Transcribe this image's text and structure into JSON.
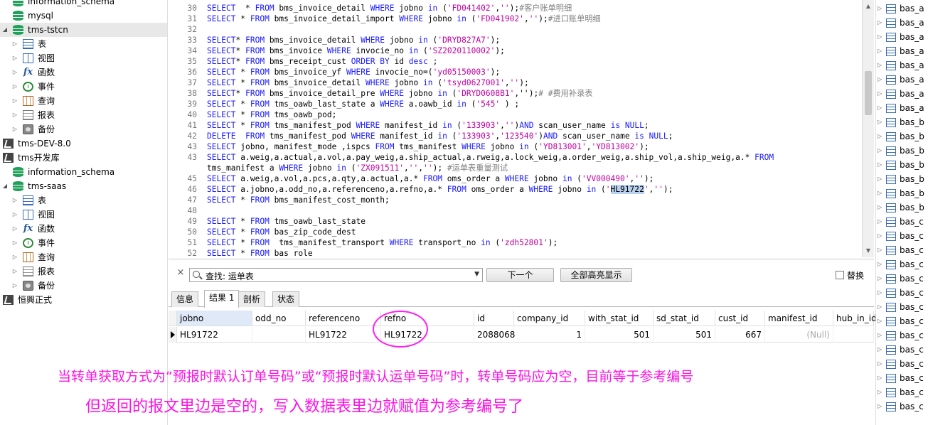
{
  "tree": [
    {
      "label": "information_schema",
      "icon": "database-icon",
      "indent": 1,
      "arrow": ""
    },
    {
      "label": "mysql",
      "icon": "database-icon",
      "indent": 1,
      "arrow": ""
    },
    {
      "label": "tms-tstcn",
      "icon": "database-icon",
      "indent": 1,
      "arrow": "open",
      "selected": true
    },
    {
      "label": "表",
      "icon": "table-icon",
      "indent": 2,
      "arrow": "closed"
    },
    {
      "label": "视图",
      "icon": "view-icon",
      "indent": 2,
      "arrow": "closed"
    },
    {
      "label": "函数",
      "icon": "function-icon",
      "indent": 2,
      "arrow": "closed"
    },
    {
      "label": "事件",
      "icon": "event-icon",
      "indent": 2,
      "arrow": "closed"
    },
    {
      "label": "查询",
      "icon": "query-icon",
      "indent": 2,
      "arrow": "closed"
    },
    {
      "label": "报表",
      "icon": "report-icon",
      "indent": 2,
      "arrow": "closed"
    },
    {
      "label": "备份",
      "icon": "backup-icon",
      "indent": 2,
      "arrow": "closed"
    },
    {
      "label": "tms-DEV-8.0",
      "icon": "connection-icon",
      "indent": 0,
      "arrow": ""
    },
    {
      "label": "tms开发库",
      "icon": "connection-icon",
      "indent": 0,
      "arrow": ""
    },
    {
      "label": "information_schema",
      "icon": "database-icon",
      "indent": 1,
      "arrow": ""
    },
    {
      "label": "tms-saas",
      "icon": "database-icon",
      "indent": 1,
      "arrow": "open"
    },
    {
      "label": "表",
      "icon": "table-icon",
      "indent": 2,
      "arrow": "closed"
    },
    {
      "label": "视图",
      "icon": "view-icon",
      "indent": 2,
      "arrow": "closed"
    },
    {
      "label": "函数",
      "icon": "function-icon",
      "indent": 2,
      "arrow": "closed"
    },
    {
      "label": "事件",
      "icon": "event-icon",
      "indent": 2,
      "arrow": "closed"
    },
    {
      "label": "查询",
      "icon": "query-icon",
      "indent": 2,
      "arrow": "closed"
    },
    {
      "label": "报表",
      "icon": "report-icon",
      "indent": 2,
      "arrow": "closed"
    },
    {
      "label": "备份",
      "icon": "backup-icon",
      "indent": 2,
      "arrow": "closed"
    },
    {
      "label": "恒興正式",
      "icon": "connection-icon",
      "indent": 0,
      "arrow": ""
    }
  ],
  "fx_glyph": "fx",
  "editor": {
    "lines": [
      {
        "n": "30",
        "tokens": [
          [
            "kw",
            "SELECT"
          ],
          [
            "",
            "  * "
          ],
          [
            "kw",
            "FROM"
          ],
          [
            "",
            " bms_invoice_detail "
          ],
          [
            "kw",
            "WHERE"
          ],
          [
            "",
            " jobno "
          ],
          [
            "kw",
            "in"
          ],
          [
            "",
            " ("
          ],
          [
            "str",
            "'FD041402'"
          ],
          [
            "",
            ","
          ],
          [
            "str",
            "''"
          ],
          [
            "",
            ");"
          ],
          [
            "cmt",
            "#客户账单明细"
          ]
        ]
      },
      {
        "n": "31",
        "tokens": [
          [
            "kw",
            "SELECT"
          ],
          [
            "",
            " * "
          ],
          [
            "kw",
            "FROM"
          ],
          [
            "",
            " bms_invoice_detail_import "
          ],
          [
            "kw",
            "WHERE"
          ],
          [
            "",
            " jobno "
          ],
          [
            "kw",
            "in"
          ],
          [
            "",
            " ("
          ],
          [
            "str",
            "'FD041902'"
          ],
          [
            "",
            ","
          ],
          [
            "str",
            "''"
          ],
          [
            "",
            ");"
          ],
          [
            "cmt",
            "#进口账单明细"
          ]
        ]
      },
      {
        "n": "32",
        "tokens": []
      },
      {
        "n": "33",
        "tokens": [
          [
            "kw",
            "SELECT"
          ],
          [
            "",
            "* "
          ],
          [
            "kw",
            "FROM"
          ],
          [
            "",
            " bms_invoice_detail "
          ],
          [
            "kw",
            "WHERE"
          ],
          [
            "",
            " jobno "
          ],
          [
            "kw",
            "in"
          ],
          [
            "",
            " ("
          ],
          [
            "str",
            "'DRYD827A7'"
          ],
          [
            "",
            ");"
          ]
        ]
      },
      {
        "n": "34",
        "tokens": [
          [
            "kw",
            "SELECT"
          ],
          [
            "",
            "* "
          ],
          [
            "kw",
            "FROM"
          ],
          [
            "",
            " bms_invoice "
          ],
          [
            "kw",
            "WHERE"
          ],
          [
            "",
            " invocie_no "
          ],
          [
            "kw",
            "in"
          ],
          [
            "",
            " ("
          ],
          [
            "str",
            "'SZ2020110002'"
          ],
          [
            "",
            ");"
          ]
        ]
      },
      {
        "n": "35",
        "tokens": [
          [
            "kw",
            "SELECT"
          ],
          [
            "",
            "* "
          ],
          [
            "kw",
            "FROM"
          ],
          [
            "",
            " bms_receipt_cust "
          ],
          [
            "kw",
            "ORDER BY"
          ],
          [
            "",
            " id "
          ],
          [
            "kw",
            "desc"
          ],
          [
            "",
            " ;"
          ]
        ]
      },
      {
        "n": "36",
        "tokens": [
          [
            "kw",
            "SELECT"
          ],
          [
            "",
            " * "
          ],
          [
            "kw",
            "FROM"
          ],
          [
            "",
            " bms_invoice_yf "
          ],
          [
            "kw",
            "WHERE"
          ],
          [
            "",
            " invocie_no=("
          ],
          [
            "str",
            "'yd05150003'"
          ],
          [
            "",
            ");"
          ]
        ]
      },
      {
        "n": "37",
        "tokens": [
          [
            "kw",
            "SELECT"
          ],
          [
            "",
            " * "
          ],
          [
            "kw",
            "FROM"
          ],
          [
            "",
            " bms_invoice_detail "
          ],
          [
            "kw",
            "WHERE"
          ],
          [
            "",
            " jobno "
          ],
          [
            "kw",
            "in"
          ],
          [
            "",
            " ("
          ],
          [
            "str",
            "'tsyd0627001'"
          ],
          [
            "",
            ","
          ],
          [
            "str",
            "''"
          ],
          [
            "",
            ");"
          ]
        ]
      },
      {
        "n": "38",
        "tokens": [
          [
            "kw",
            "SELECT"
          ],
          [
            "",
            "* "
          ],
          [
            "kw",
            "FROM"
          ],
          [
            "",
            " bms_invoice_detail_pre "
          ],
          [
            "kw",
            "WHERE"
          ],
          [
            "",
            " jobno "
          ],
          [
            "kw",
            "in"
          ],
          [
            "",
            " ("
          ],
          [
            "str",
            "'DRYD0608B1'"
          ],
          [
            "",
            ",'');"
          ],
          [
            "cmt",
            "# #费用补录表"
          ]
        ]
      },
      {
        "n": "39",
        "tokens": [
          [
            "kw",
            "SELECT"
          ],
          [
            "",
            " * "
          ],
          [
            "kw",
            "FROM"
          ],
          [
            "",
            " tms_oawb_last_state a "
          ],
          [
            "kw",
            "WHERE"
          ],
          [
            "",
            " a.oawb_id "
          ],
          [
            "kw",
            "in"
          ],
          [
            "",
            " ("
          ],
          [
            "str",
            "'545'"
          ],
          [
            "",
            " ) ;"
          ]
        ]
      },
      {
        "n": "40",
        "tokens": [
          [
            "kw",
            "SELECT"
          ],
          [
            "",
            " * "
          ],
          [
            "kw",
            "FROM"
          ],
          [
            "",
            " tms_oawb_pod;"
          ]
        ]
      },
      {
        "n": "41",
        "tokens": [
          [
            "kw",
            "SELECT"
          ],
          [
            "",
            " * "
          ],
          [
            "kw",
            "FROM"
          ],
          [
            "",
            " tms_manifest_pod "
          ],
          [
            "kw",
            "WHERE"
          ],
          [
            "",
            " manifest_id "
          ],
          [
            "kw",
            "in"
          ],
          [
            "",
            " ("
          ],
          [
            "str",
            "'133903'"
          ],
          [
            "",
            ","
          ],
          [
            "str",
            "''"
          ],
          [
            "",
            ")"
          ],
          [
            "kw",
            "AND"
          ],
          [
            "",
            " scan_user_name "
          ],
          [
            "kw",
            "is NULL"
          ],
          [
            "",
            ";"
          ]
        ]
      },
      {
        "n": "42",
        "tokens": [
          [
            "kw",
            "DELETE"
          ],
          [
            "",
            "  "
          ],
          [
            "kw",
            "FROM"
          ],
          [
            "",
            " tms_manifest_pod "
          ],
          [
            "kw",
            "WHERE"
          ],
          [
            "",
            " manifest_id "
          ],
          [
            "kw",
            "in"
          ],
          [
            "",
            " ("
          ],
          [
            "str",
            "'133903'"
          ],
          [
            "",
            ","
          ],
          [
            "str",
            "'123540'"
          ],
          [
            "",
            ")"
          ],
          [
            "kw",
            "AND"
          ],
          [
            "",
            " scan_user_name "
          ],
          [
            "kw",
            "is NULL"
          ],
          [
            "",
            ";"
          ]
        ]
      },
      {
        "n": "43",
        "tokens": [
          [
            "kw",
            "SELECT"
          ],
          [
            "",
            " jobno, manifest_mode ,ispcs "
          ],
          [
            "kw",
            "FROM"
          ],
          [
            "",
            " tms_manifest "
          ],
          [
            "kw",
            "WHERE"
          ],
          [
            "",
            " jobno "
          ],
          [
            "kw",
            "in"
          ],
          [
            "",
            " ("
          ],
          [
            "str",
            "'YD813001'"
          ],
          [
            "",
            ","
          ],
          [
            "str",
            "'YD813002'"
          ],
          [
            "",
            ");"
          ]
        ]
      },
      {
        "n": "43",
        "tokens": [
          [
            "kw",
            "SELECT"
          ],
          [
            "",
            " a.weig,a.actual,a.vol,a.pay_weig,a.ship_actual,a.rweig,a.lock_weig,a.order_weig,a.ship_vol,a.ship_weig,a.* "
          ],
          [
            "kw",
            "FROM"
          ]
        ]
      },
      {
        "n": "",
        "tokens": [
          [
            "",
            "tms_manifest a "
          ],
          [
            "kw",
            "WHERE"
          ],
          [
            "",
            " jobno "
          ],
          [
            "kw",
            "in"
          ],
          [
            "",
            " ("
          ],
          [
            "str",
            "'ZX091511'"
          ],
          [
            "",
            ","
          ],
          [
            "str",
            "''"
          ],
          [
            "",
            ","
          ],
          [
            "str",
            "''"
          ],
          [
            "",
            "); "
          ],
          [
            "cmt",
            "#运单表重量测试"
          ]
        ]
      },
      {
        "n": "45",
        "tokens": [
          [
            "kw",
            "SELECT"
          ],
          [
            "",
            " a.weig,a.vol,a.pcs,a.qty,a.actual,a.* "
          ],
          [
            "kw",
            "FROM"
          ],
          [
            "",
            " oms_order a "
          ],
          [
            "kw",
            "WHERE"
          ],
          [
            "",
            " jobno "
          ],
          [
            "kw",
            "in"
          ],
          [
            "",
            " ("
          ],
          [
            "str",
            "'VV000490'"
          ],
          [
            "",
            ","
          ],
          [
            "str",
            "''"
          ],
          [
            "",
            ");"
          ]
        ]
      },
      {
        "n": "46",
        "tokens": [
          [
            "kw",
            "SELECT"
          ],
          [
            "",
            " a.jobno,a.odd_no,a.referenceno,a.refno,a.* "
          ],
          [
            "kw",
            "FROM"
          ],
          [
            "",
            " oms_order a "
          ],
          [
            "kw",
            "WHERE"
          ],
          [
            "",
            " jobno "
          ],
          [
            "kw",
            "in"
          ],
          [
            "",
            " ("
          ],
          [
            "str",
            "'"
          ],
          [
            "hl",
            "HL91722"
          ],
          [
            "str",
            "'"
          ],
          [
            "",
            ","
          ],
          [
            "str",
            "''"
          ],
          [
            "",
            ");"
          ]
        ]
      },
      {
        "n": "47",
        "tokens": [
          [
            "kw",
            "SELECT"
          ],
          [
            "",
            " * "
          ],
          [
            "kw",
            "FROM"
          ],
          [
            "",
            " bms_manifest_cost_month;"
          ]
        ]
      },
      {
        "n": "48",
        "tokens": []
      },
      {
        "n": "49",
        "tokens": [
          [
            "kw",
            "SELECT"
          ],
          [
            "",
            " * "
          ],
          [
            "kw",
            "FROM"
          ],
          [
            "",
            " tms_oawb_last_state"
          ]
        ]
      },
      {
        "n": "50",
        "tokens": [
          [
            "kw",
            "SELECT"
          ],
          [
            "",
            " * "
          ],
          [
            "kw",
            "FROM"
          ],
          [
            "",
            " bas_zip_code_dest"
          ]
        ]
      },
      {
        "n": "51",
        "tokens": [
          [
            "kw",
            "SELECT"
          ],
          [
            "",
            " * "
          ],
          [
            "kw",
            "FROM"
          ],
          [
            "",
            "  tms_manifest_transport "
          ],
          [
            "kw",
            "WHERE"
          ],
          [
            "",
            " transport_no "
          ],
          [
            "kw",
            "in"
          ],
          [
            "",
            " ("
          ],
          [
            "str",
            "'zdh52801'"
          ],
          [
            "",
            ");"
          ]
        ]
      },
      {
        "n": "52",
        "tokens": [
          [
            "kw",
            "SELECT"
          ],
          [
            "",
            " * "
          ],
          [
            "kw",
            "FROM"
          ],
          [
            "",
            " bas_role"
          ]
        ]
      }
    ]
  },
  "findbar": {
    "close": "×",
    "search_value": "查找: 运单表",
    "next_label": "下一个",
    "highlight_all_label": "全部高亮显示",
    "replace_label": "替换"
  },
  "tabs": [
    "信息",
    "结果 1",
    "剖析",
    "状态"
  ],
  "active_tab": 1,
  "grid": {
    "columns": [
      "jobno",
      "odd_no",
      "referenceno",
      "refno",
      "id",
      "company_id",
      "with_stat_id",
      "sd_stat_id",
      "cust_id",
      "manifest_id",
      "hub_in_id"
    ],
    "row": [
      "HL91722",
      "",
      "HL91722",
      "HL91722",
      "2088068",
      "1",
      "501",
      "501",
      "667",
      "(Null)",
      ""
    ]
  },
  "annotations": {
    "line1": "当转单获取方式为“预报时默认订单号码”或“预报时默认运单号码”时，转单号码应为空，目前等于参考编号",
    "line2": "但返回的报文里边是空的，写入数据表里边就赋值为参考编号了",
    "color": "#ff10e8"
  },
  "right_panel": {
    "items": [
      "bas_a",
      "bas_a",
      "bas_a",
      "bas_a",
      "bas_a",
      "bas_a",
      "bas_a",
      "bas_a",
      "bas_b",
      "bas_b",
      "bas_b",
      "bas_b",
      "bas_b",
      "bas_b",
      "bas_b",
      "bas_c",
      "bas_c",
      "bas_c",
      "bas_c",
      "bas_c",
      "bas_c",
      "bas_c",
      "bas_c",
      "bas_c",
      "bas_c",
      "bas_c",
      "bas_c",
      "bas_c",
      "bas_c"
    ]
  }
}
